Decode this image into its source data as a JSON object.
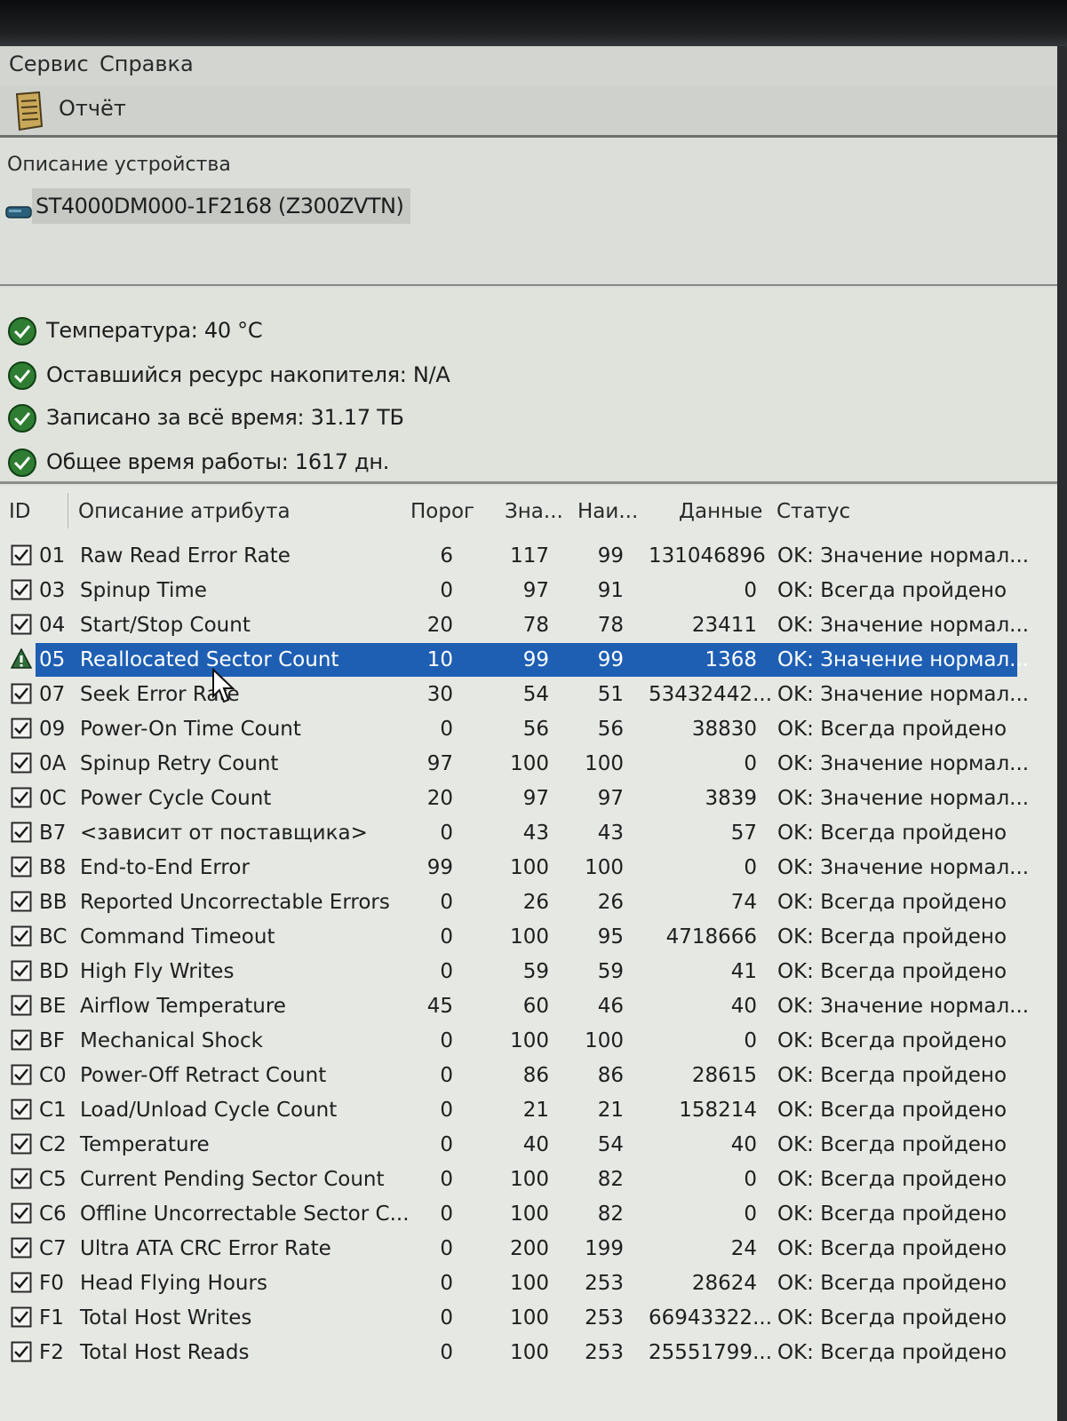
{
  "menu": {
    "items": [
      "Сервис",
      "Справка"
    ]
  },
  "toolbar": {
    "report_label": "Отчёт"
  },
  "device": {
    "heading": "Описание устройства",
    "name": "ST4000DM000-1F2168 (Z300ZVTN)"
  },
  "status": {
    "temperature": "Температура: 40 °C",
    "remaining": "Оставшийся ресурс накопителя: N/A",
    "written": "Записано за всё время: 31.17 ТБ",
    "uptime": "Общее время работы: 1617 дн."
  },
  "table": {
    "headers": {
      "id": "ID",
      "desc": "Описание атрибута",
      "threshold": "Порог",
      "value": "Зна...",
      "worst": "Наи...",
      "data": "Данные",
      "status": "Статус"
    },
    "rows": [
      {
        "icon": "check",
        "id": "01",
        "desc": "Raw Read Error Rate",
        "threshold": "6",
        "value": "117",
        "worst": "99",
        "data": "131046896",
        "status": "OK: Значение нормал..."
      },
      {
        "icon": "check",
        "id": "03",
        "desc": "Spinup Time",
        "threshold": "0",
        "value": "97",
        "worst": "91",
        "data": "0",
        "status": "OK: Всегда пройдено"
      },
      {
        "icon": "check",
        "id": "04",
        "desc": "Start/Stop Count",
        "threshold": "20",
        "value": "78",
        "worst": "78",
        "data": "23411",
        "status": "OK: Значение нормал..."
      },
      {
        "icon": "warning",
        "id": "05",
        "desc": "Reallocated Sector Count",
        "threshold": "10",
        "value": "99",
        "worst": "99",
        "data": "1368",
        "status": "OK: Значение нормал...",
        "selected": true
      },
      {
        "icon": "check",
        "id": "07",
        "desc": "Seek Error Rate",
        "threshold": "30",
        "value": "54",
        "worst": "51",
        "data": "53432442...",
        "status": "OK: Значение нормал..."
      },
      {
        "icon": "check",
        "id": "09",
        "desc": "Power-On Time Count",
        "threshold": "0",
        "value": "56",
        "worst": "56",
        "data": "38830",
        "status": "OK: Всегда пройдено"
      },
      {
        "icon": "check",
        "id": "0A",
        "desc": "Spinup Retry Count",
        "threshold": "97",
        "value": "100",
        "worst": "100",
        "data": "0",
        "status": "OK: Значение нормал..."
      },
      {
        "icon": "check",
        "id": "0C",
        "desc": "Power Cycle Count",
        "threshold": "20",
        "value": "97",
        "worst": "97",
        "data": "3839",
        "status": "OK: Значение нормал..."
      },
      {
        "icon": "check",
        "id": "B7",
        "desc": "<зависит от поставщика>",
        "threshold": "0",
        "value": "43",
        "worst": "43",
        "data": "57",
        "status": "OK: Всегда пройдено"
      },
      {
        "icon": "check",
        "id": "B8",
        "desc": "End-to-End Error",
        "threshold": "99",
        "value": "100",
        "worst": "100",
        "data": "0",
        "status": "OK: Значение нормал..."
      },
      {
        "icon": "check",
        "id": "BB",
        "desc": "Reported Uncorrectable Errors",
        "threshold": "0",
        "value": "26",
        "worst": "26",
        "data": "74",
        "status": "OK: Всегда пройдено"
      },
      {
        "icon": "check",
        "id": "BC",
        "desc": "Command Timeout",
        "threshold": "0",
        "value": "100",
        "worst": "95",
        "data": "4718666",
        "status": "OK: Всегда пройдено"
      },
      {
        "icon": "check",
        "id": "BD",
        "desc": "High Fly Writes",
        "threshold": "0",
        "value": "59",
        "worst": "59",
        "data": "41",
        "status": "OK: Всегда пройдено"
      },
      {
        "icon": "check",
        "id": "BE",
        "desc": "Airflow Temperature",
        "threshold": "45",
        "value": "60",
        "worst": "46",
        "data": "40",
        "status": "OK: Значение нормал..."
      },
      {
        "icon": "check",
        "id": "BF",
        "desc": "Mechanical Shock",
        "threshold": "0",
        "value": "100",
        "worst": "100",
        "data": "0",
        "status": "OK: Всегда пройдено"
      },
      {
        "icon": "check",
        "id": "C0",
        "desc": "Power-Off Retract Count",
        "threshold": "0",
        "value": "86",
        "worst": "86",
        "data": "28615",
        "status": "OK: Всегда пройдено"
      },
      {
        "icon": "check",
        "id": "C1",
        "desc": "Load/Unload Cycle Count",
        "threshold": "0",
        "value": "21",
        "worst": "21",
        "data": "158214",
        "status": "OK: Всегда пройдено"
      },
      {
        "icon": "check",
        "id": "C2",
        "desc": "Temperature",
        "threshold": "0",
        "value": "40",
        "worst": "54",
        "data": "40",
        "status": "OK: Всегда пройдено"
      },
      {
        "icon": "check",
        "id": "C5",
        "desc": "Current Pending Sector Count",
        "threshold": "0",
        "value": "100",
        "worst": "82",
        "data": "0",
        "status": "OK: Всегда пройдено"
      },
      {
        "icon": "check",
        "id": "C6",
        "desc": "Offline Uncorrectable Sector C...",
        "threshold": "0",
        "value": "100",
        "worst": "82",
        "data": "0",
        "status": "OK: Всегда пройдено"
      },
      {
        "icon": "check",
        "id": "C7",
        "desc": "Ultra ATA CRC Error Rate",
        "threshold": "0",
        "value": "200",
        "worst": "199",
        "data": "24",
        "status": "OK: Всегда пройдено"
      },
      {
        "icon": "check",
        "id": "F0",
        "desc": "Head Flying Hours",
        "threshold": "0",
        "value": "100",
        "worst": "253",
        "data": "28624",
        "status": "OK: Всегда пройдено"
      },
      {
        "icon": "check",
        "id": "F1",
        "desc": "Total Host Writes",
        "threshold": "0",
        "value": "100",
        "worst": "253",
        "data": "66943322...",
        "status": "OK: Всегда пройдено"
      },
      {
        "icon": "check",
        "id": "F2",
        "desc": "Total Host Reads",
        "threshold": "0",
        "value": "100",
        "worst": "253",
        "data": "25551799...",
        "status": "OK: Всегда пройдено"
      }
    ]
  },
  "colors": {
    "selection": "#1e5fb4",
    "ok_green": "#2e7d32",
    "warning": "#2f6d3a"
  }
}
